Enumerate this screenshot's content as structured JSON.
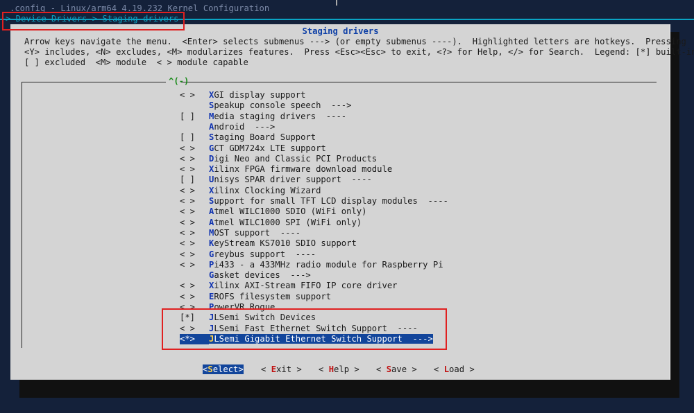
{
  "terminal": {
    "title": ".config - Linux/arm64 4.19.232 Kernel Configuration",
    "breadcrumb": "> Device Drivers > Staging drivers -"
  },
  "dialog": {
    "title": "Staging drivers",
    "help_lines": [
      "Arrow keys navigate the menu.  <Enter> selects submenus ---> (or empty submenus ----).  Highlighted letters are hotkeys.  Pressing",
      "<Y> includes, <N> excludes, <M> modularizes features.  Press <Esc><Esc> to exit, <?> for Help, </> for Search.  Legend: [*] built-in",
      "[ ] excluded  <M> module  < > module capable"
    ],
    "scroll_indicator": "^(-)"
  },
  "menu": {
    "items": [
      {
        "state": "< >",
        "hotkey": "X",
        "rest": "GI display support"
      },
      {
        "state": "",
        "hotkey": "S",
        "rest": "peakup console speech  --->"
      },
      {
        "state": "[ ]",
        "hotkey": "M",
        "rest": "edia staging drivers  ----"
      },
      {
        "state": "",
        "hotkey": "A",
        "rest": "ndroid  --->"
      },
      {
        "state": "[ ]",
        "hotkey": "S",
        "rest": "taging Board Support"
      },
      {
        "state": "< >",
        "hotkey": "G",
        "rest": "CT GDM724x LTE support"
      },
      {
        "state": "< >",
        "hotkey": "D",
        "rest": "igi Neo and Classic PCI Products"
      },
      {
        "state": "< >",
        "hotkey": "X",
        "rest": "ilinx FPGA firmware download module"
      },
      {
        "state": "[ ]",
        "hotkey": "U",
        "rest": "nisys SPAR driver support  ----"
      },
      {
        "state": "< >",
        "hotkey": "X",
        "rest": "ilinx Clocking Wizard"
      },
      {
        "state": "< >",
        "hotkey": "S",
        "rest": "upport for small TFT LCD display modules  ----"
      },
      {
        "state": "< >",
        "hotkey": "A",
        "rest": "tmel WILC1000 SDIO (WiFi only)"
      },
      {
        "state": "< >",
        "hotkey": "A",
        "rest": "tmel WILC1000 SPI (WiFi only)"
      },
      {
        "state": "< >",
        "hotkey": "M",
        "rest": "OST support  ----"
      },
      {
        "state": "< >",
        "hotkey": "K",
        "rest": "eyStream KS7010 SDIO support"
      },
      {
        "state": "< >",
        "hotkey": "G",
        "rest": "reybus support  ----"
      },
      {
        "state": "< >",
        "hotkey": "P",
        "rest": "i433 - a 433MHz radio module for Raspberry Pi"
      },
      {
        "state": "",
        "hotkey": "G",
        "rest": "asket devices  --->"
      },
      {
        "state": "< >",
        "hotkey": "X",
        "rest": "ilinx AXI-Stream FIFO IP core driver"
      },
      {
        "state": "< >",
        "hotkey": "E",
        "rest": "ROFS filesystem support"
      },
      {
        "state": "< >",
        "hotkey": "P",
        "rest": "owerVR Rogue"
      },
      {
        "state": "[*]",
        "hotkey": "J",
        "rest": "LSemi Switch Devices"
      },
      {
        "state": "< >",
        "hotkey": "J",
        "rest": "LSemi Fast Ethernet Switch Support  ----"
      },
      {
        "state": "<*>",
        "hotkey": "J",
        "rest": "LSemi Gigabit Ethernet Switch Support  --->",
        "selected": true
      }
    ]
  },
  "buttons": [
    {
      "pre": "<",
      "hot": "S",
      "rest": "elect",
      "post": ">",
      "selected": true
    },
    {
      "pre": "< ",
      "hot": "E",
      "rest": "xit",
      "post": " >"
    },
    {
      "pre": "< ",
      "hot": "H",
      "rest": "elp",
      "post": " >"
    },
    {
      "pre": "< ",
      "hot": "S",
      "rest": "ave",
      "post": " >"
    },
    {
      "pre": "< ",
      "hot": "L",
      "rest": "oad",
      "post": " >"
    }
  ],
  "colors": {
    "terminal_bg": "#14213a",
    "dialog_bg": "#d4d4d4",
    "highlight": "#12459b",
    "hotkey": "#1033b0",
    "annotation": "#e02020"
  }
}
